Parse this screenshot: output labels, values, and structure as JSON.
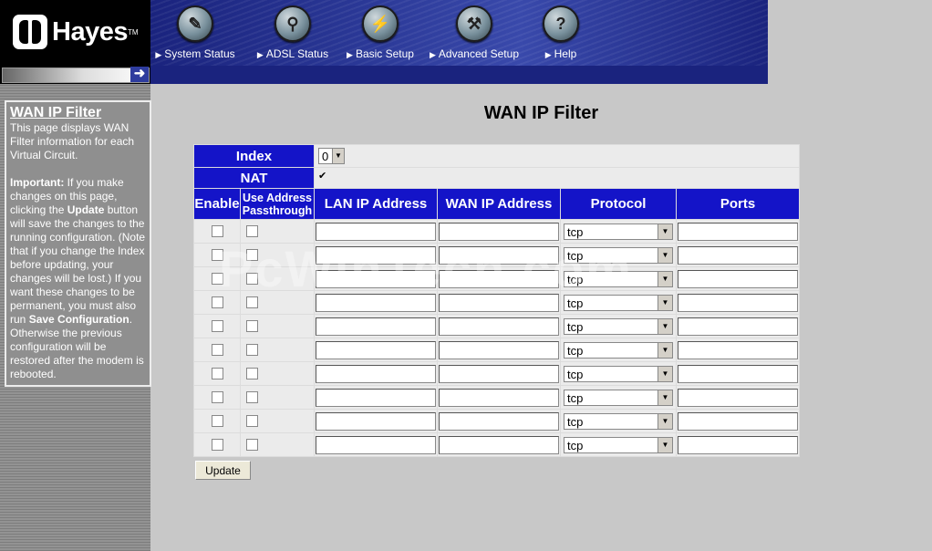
{
  "brand": {
    "name": "Hayes",
    "tm": "TM"
  },
  "nav": [
    {
      "label": "System Status",
      "icon": "document-icon",
      "glyph": "✎"
    },
    {
      "label": "ADSL Status",
      "icon": "magnifier-icon",
      "glyph": "⚲"
    },
    {
      "label": "Basic Setup",
      "icon": "plug-icon",
      "glyph": "⚡"
    },
    {
      "label": "Advanced Setup",
      "icon": "wrench-icon",
      "glyph": "⚒"
    },
    {
      "label": "Help",
      "icon": "question-icon",
      "glyph": "?"
    }
  ],
  "sidebar": {
    "title": "WAN IP Filter",
    "intro": "This page displays WAN Filter information for each Virtual Circuit.",
    "important_label": "Important:",
    "text1": " If you make changes on this page, clicking the ",
    "update_word": "Update",
    "text2": " button will save the changes to the running configuration. (Note that if you change the Index before updating, your changes will be lost.) If you want these changes to be permanent, you must also run ",
    "save_word": "Save Configuration",
    "text3": ". Otherwise the previous configuration will be restored after the modem is rebooted."
  },
  "page_title": "WAN IP Filter",
  "form": {
    "index_label": "Index",
    "index_value": "0",
    "nat_label": "NAT",
    "nat_checked": true,
    "columns": {
      "enable": "Enable",
      "passthrough": "Use Address Passthrough",
      "lan": "LAN IP Address",
      "wan": "WAN IP Address",
      "protocol": "Protocol",
      "ports": "Ports"
    },
    "rows": [
      {
        "enable": false,
        "passthrough": false,
        "lan": "",
        "wan": "",
        "protocol": "tcp",
        "ports": ""
      },
      {
        "enable": false,
        "passthrough": false,
        "lan": "",
        "wan": "",
        "protocol": "tcp",
        "ports": ""
      },
      {
        "enable": false,
        "passthrough": false,
        "lan": "",
        "wan": "",
        "protocol": "tcp",
        "ports": ""
      },
      {
        "enable": false,
        "passthrough": false,
        "lan": "",
        "wan": "",
        "protocol": "tcp",
        "ports": ""
      },
      {
        "enable": false,
        "passthrough": false,
        "lan": "",
        "wan": "",
        "protocol": "tcp",
        "ports": ""
      },
      {
        "enable": false,
        "passthrough": false,
        "lan": "",
        "wan": "",
        "protocol": "tcp",
        "ports": ""
      },
      {
        "enable": false,
        "passthrough": false,
        "lan": "",
        "wan": "",
        "protocol": "tcp",
        "ports": ""
      },
      {
        "enable": false,
        "passthrough": false,
        "lan": "",
        "wan": "",
        "protocol": "tcp",
        "ports": ""
      },
      {
        "enable": false,
        "passthrough": false,
        "lan": "",
        "wan": "",
        "protocol": "tcp",
        "ports": ""
      },
      {
        "enable": false,
        "passthrough": false,
        "lan": "",
        "wan": "",
        "protocol": "tcp",
        "ports": ""
      }
    ],
    "update_label": "Update"
  },
  "watermark": "PcWinTech.com",
  "colors": {
    "header_blue": "#1414c8",
    "nav_blue": "#283593",
    "page_bg": "#c8c8c8"
  }
}
